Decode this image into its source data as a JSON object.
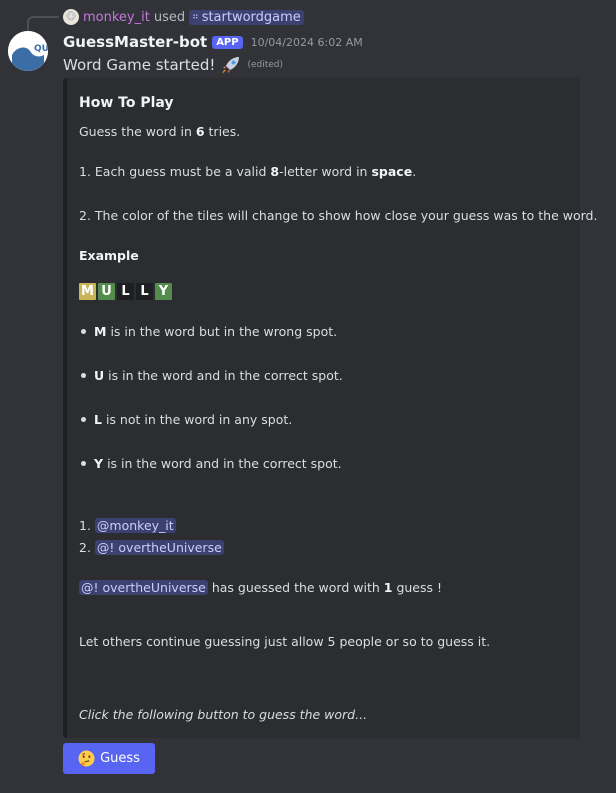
{
  "reply": {
    "user": "monkey_it",
    "used": "used",
    "command": "startwordgame"
  },
  "bot": {
    "name": "GuessMaster-bot",
    "tag": "APP",
    "timestamp": "10/04/2024 6:02 AM",
    "avatar_text": "QU"
  },
  "message": {
    "text": "Word Game started!",
    "edited": "(edited)"
  },
  "embed": {
    "title": "How To Play",
    "intro_pre": "Guess the word in ",
    "tries": "6",
    "intro_post": " tries.",
    "rule1_pre": "1. Each guess must be a valid ",
    "letters": "8",
    "rule1_mid": "-letter word in ",
    "category": "space",
    "rule1_post": ".",
    "rule2": "2. The color of the tiles will change to show how close your guess was to the word.",
    "example_title": "Example",
    "tiles": [
      {
        "letter": "M",
        "color": "#c9b458"
      },
      {
        "letter": "U",
        "color": "#538d4e"
      },
      {
        "letter": "L",
        "color": "#1e1f22"
      },
      {
        "letter": "L",
        "color": "#1e1f22"
      },
      {
        "letter": "Y",
        "color": "#538d4e"
      }
    ],
    "bullets": [
      {
        "letter": "M",
        "text": "is in the word but in the wrong spot."
      },
      {
        "letter": "U",
        "text": "is in the word and in the correct spot."
      },
      {
        "letter": "L",
        "text": "is not in the word in any spot."
      },
      {
        "letter": "Y",
        "text": "is in the word and in the correct spot."
      }
    ],
    "leaderboard": [
      {
        "rank": "1.",
        "mention": "@monkey_it"
      },
      {
        "rank": "2.",
        "mention": "@! overtheUniverse"
      }
    ],
    "winner_mention": "@! overtheUniverse",
    "winner_pre": " has guessed the word with ",
    "winner_count": "1",
    "winner_post": " guess !",
    "note": "Let others continue guessing just allow 5 people or so to guess it.",
    "footer": "Click the following button to guess the word..."
  },
  "button": {
    "label": "Guess",
    "color": "#5865f2"
  }
}
